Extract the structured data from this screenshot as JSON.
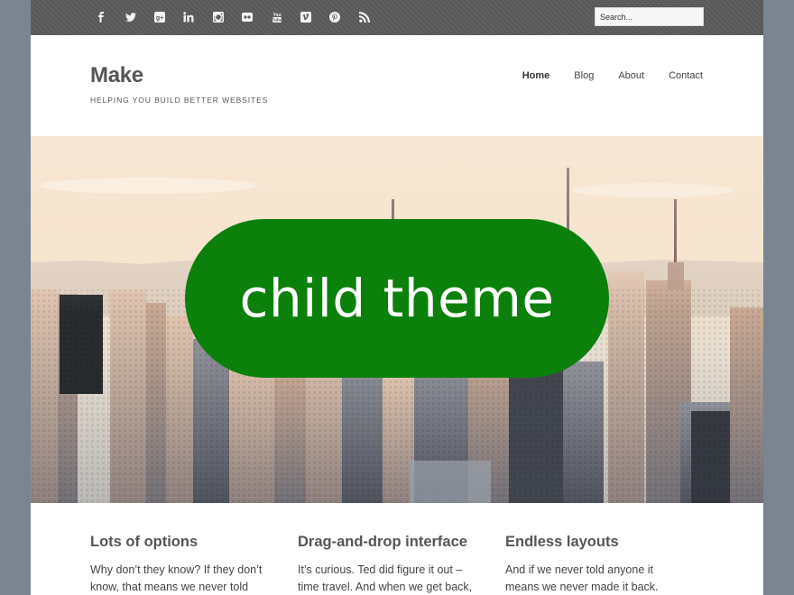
{
  "social": {
    "icons": [
      {
        "name": "facebook-icon",
        "glyph": "f"
      },
      {
        "name": "twitter-icon",
        "glyph": "t"
      },
      {
        "name": "google-plus-icon",
        "glyph": "g+"
      },
      {
        "name": "linkedin-icon",
        "glyph": "in"
      },
      {
        "name": "instagram-icon",
        "glyph": "ig"
      },
      {
        "name": "flickr-icon",
        "glyph": "fl"
      },
      {
        "name": "youtube-icon",
        "glyph": "yt"
      },
      {
        "name": "vimeo-icon",
        "glyph": "v"
      },
      {
        "name": "pinterest-icon",
        "glyph": "p"
      },
      {
        "name": "rss-icon",
        "glyph": "rss"
      }
    ]
  },
  "search": {
    "placeholder": "Search..."
  },
  "site": {
    "title": "Make",
    "tagline": "HELPING YOU BUILD BETTER WEBSITES"
  },
  "nav": {
    "items": [
      {
        "label": "Home",
        "active": true
      },
      {
        "label": "Blog",
        "active": false
      },
      {
        "label": "About",
        "active": false
      },
      {
        "label": "Contact",
        "active": false
      }
    ]
  },
  "hero": {
    "badge_text": "child theme",
    "badge_color": "#0b800b"
  },
  "features": [
    {
      "title": "Lots of options",
      "text": "Why don’t they know? If they don’t know, that means we never told"
    },
    {
      "title": "Drag-and-drop interface",
      "text": "It’s curious. Ted did figure it out – time travel. And when we get back,"
    },
    {
      "title": "Endless layouts",
      "text": "And if we never told anyone it means we never made it back. Hence we die"
    }
  ],
  "colors": {
    "background": "#7a8591",
    "topbar": "#5b5b5b",
    "accent": "#0b800b"
  }
}
